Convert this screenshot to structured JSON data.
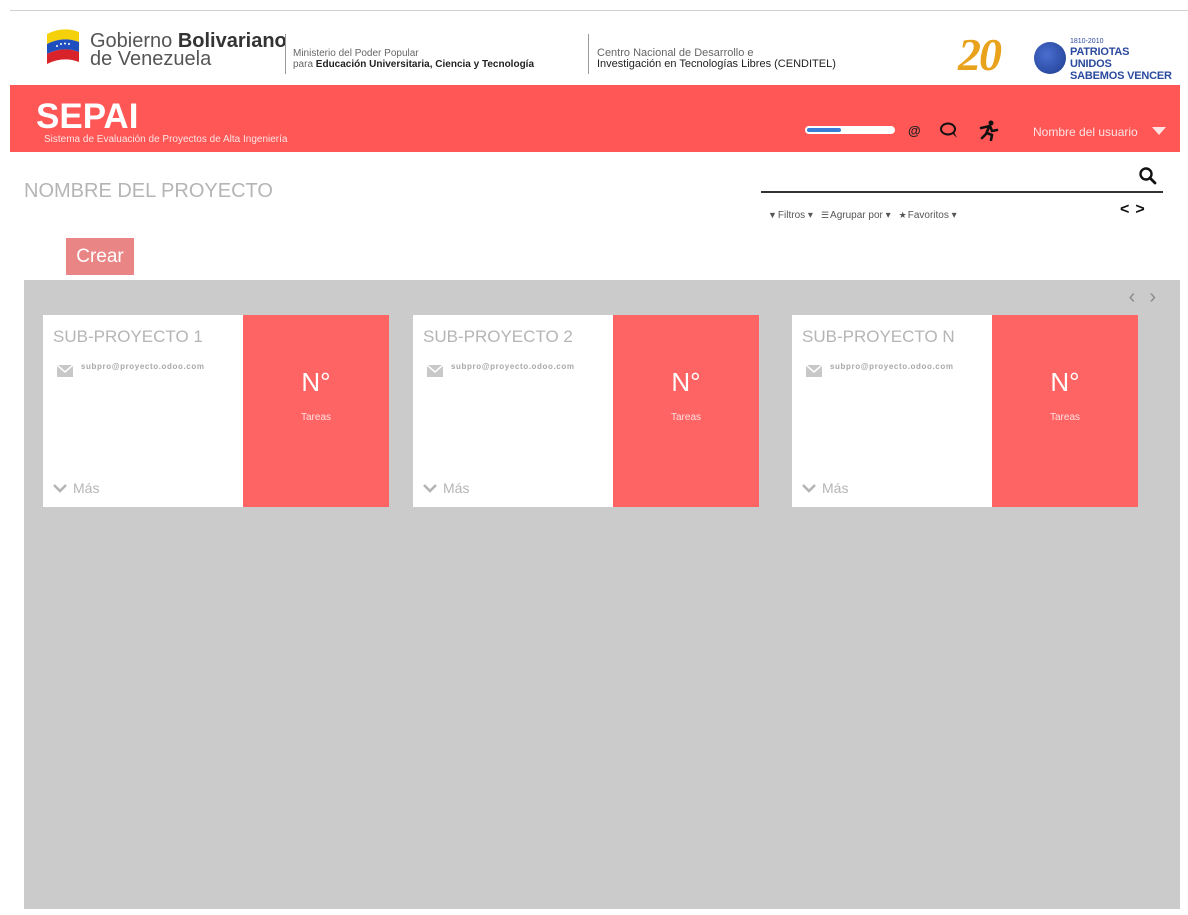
{
  "banner": {
    "gov_line1_prefix": "Gobierno",
    "gov_line1_bold": "Bolivariano",
    "gov_line2": "de Venezuela",
    "ministry_line1": "Ministerio del Poder Popular",
    "ministry_line2_prefix": "para",
    "ministry_line2_bold": "Educación Universitaria, Ciencia y Tecnología",
    "cenditel_line1": "Centro Nacional de Desarrollo e",
    "cenditel_line2": "Investigación en Tecnologías Libres (CENDITEL)",
    "bicentenario_number": "20",
    "bicentenario_years": "1810-2010",
    "bicentenario_slogan1": "PATRIOTAS UNIDOS",
    "bicentenario_slogan2": "SABEMOS VENCER"
  },
  "header": {
    "app_title": "SEPAI",
    "app_subtitle": "Sistema de Evaluación de Proyectos de Alta Ingeniería",
    "progress_fraction": 0.4,
    "icons": [
      "at-icon",
      "chat-icon",
      "activity-icon"
    ],
    "at_symbol": "@",
    "user_name": "Nombre del usuario",
    "colors": {
      "header_bg": "#ff5656",
      "progress": "#3a7bd5"
    }
  },
  "toolbar": {
    "project_title": "NOMBRE DEL PROYECTO",
    "search_placeholder": "",
    "filters_label": "Filtros",
    "group_by_label": "Agrupar por",
    "favorites_label": "Favoritos",
    "prev_label": "<",
    "next_label": ">",
    "create_label": "Crear"
  },
  "kanban": {
    "prev_label": "‹",
    "next_label": "›",
    "cards": [
      {
        "title": "SUB-PROYECTO 1",
        "email": "subpro@proyecto.odoo.com",
        "more_label": "Más",
        "count": "N°",
        "count_label": "Tareas"
      },
      {
        "title": "SUB-PROYECTO 2",
        "email": "subpro@proyecto.odoo.com",
        "more_label": "Más",
        "count": "N°",
        "count_label": "Tareas"
      },
      {
        "title": "SUB-PROYECTO N",
        "email": "subpro@proyecto.odoo.com",
        "more_label": "Más",
        "count": "N°",
        "count_label": "Tareas"
      }
    ]
  }
}
